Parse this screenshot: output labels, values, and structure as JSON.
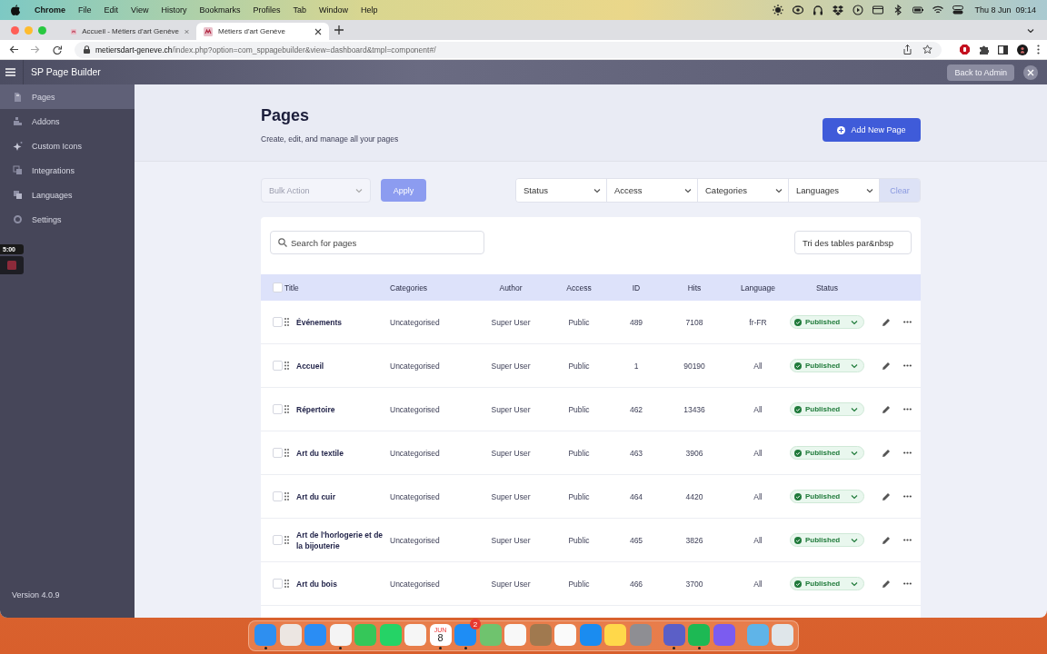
{
  "menubar": {
    "app": "Chrome",
    "menus": [
      "File",
      "Edit",
      "View",
      "History",
      "Bookmarks",
      "Profiles",
      "Tab",
      "Window",
      "Help"
    ],
    "clock": "Thu 8 Jun  09:14"
  },
  "browser": {
    "tabs": [
      {
        "title": "Accueil - Métiers d'art Genève",
        "selected": false
      },
      {
        "title": "Métiers d'art Genève",
        "selected": true
      }
    ],
    "url": {
      "host": "metiersdart-geneve.ch",
      "path": "/index.php?option=com_sppagebuilder&view=dashboard&tmpl=component#/"
    }
  },
  "app": {
    "title": "SP Page Builder",
    "back_button": "Back to Admin"
  },
  "sidebar": {
    "items": [
      {
        "label": "Pages",
        "selected": true
      },
      {
        "label": "Addons",
        "selected": false
      },
      {
        "label": "Custom Icons",
        "selected": false
      },
      {
        "label": "Integrations",
        "selected": false
      },
      {
        "label": "Languages",
        "selected": false
      },
      {
        "label": "Settings",
        "selected": false
      }
    ],
    "version": "Version 4.0.9"
  },
  "recording_widget": {
    "time": "5:00"
  },
  "page": {
    "title": "Pages",
    "subtitle": "Create, edit, and manage all your pages",
    "add_button": "Add New Page"
  },
  "toolbar": {
    "bulk_action": "Bulk Action",
    "apply": "Apply",
    "filters": [
      "Status",
      "Access",
      "Categories",
      "Languages"
    ],
    "clear": "Clear"
  },
  "search": {
    "placeholder": "Search for pages"
  },
  "sort_select": {
    "value": "Tri des tables par&nbsp"
  },
  "table": {
    "columns": [
      "Title",
      "Categories",
      "Author",
      "Access",
      "ID",
      "Hits",
      "Language",
      "Status"
    ],
    "all_checked": false,
    "rows": [
      {
        "title": "Événements",
        "category": "Uncategorised",
        "author": "Super User",
        "access": "Public",
        "id": "489",
        "hits": "7108",
        "language": "fr-FR",
        "status": "Published",
        "checked": false
      },
      {
        "title": "Accueil",
        "category": "Uncategorised",
        "author": "Super User",
        "access": "Public",
        "id": "1",
        "hits": "90190",
        "language": "All",
        "status": "Published",
        "checked": false
      },
      {
        "title": "Répertoire",
        "category": "Uncategorised",
        "author": "Super User",
        "access": "Public",
        "id": "462",
        "hits": "13436",
        "language": "All",
        "status": "Published",
        "checked": false
      },
      {
        "title": "Art du textile",
        "category": "Uncategorised",
        "author": "Super User",
        "access": "Public",
        "id": "463",
        "hits": "3906",
        "language": "All",
        "status": "Published",
        "checked": false
      },
      {
        "title": "Art du cuir",
        "category": "Uncategorised",
        "author": "Super User",
        "access": "Public",
        "id": "464",
        "hits": "4420",
        "language": "All",
        "status": "Published",
        "checked": false
      },
      {
        "title": "Art de l'horlogerie et de la bijouterie",
        "category": "Uncategorised",
        "author": "Super User",
        "access": "Public",
        "id": "465",
        "hits": "3826",
        "language": "All",
        "status": "Published",
        "checked": false
      },
      {
        "title": "Art du bois",
        "category": "Uncategorised",
        "author": "Super User",
        "access": "Public",
        "id": "466",
        "hits": "3700",
        "language": "All",
        "status": "Published",
        "checked": false
      }
    ]
  },
  "dock": {
    "items": [
      {
        "kind": "app",
        "color": "#2e8ff0",
        "running": true
      },
      {
        "kind": "app",
        "color": "#ece6e2",
        "running": false
      },
      {
        "kind": "app",
        "color": "#2a8df4",
        "running": false
      },
      {
        "kind": "app",
        "color": "#f4f4f4",
        "running": true
      },
      {
        "kind": "app",
        "color": "#35c759",
        "running": false
      },
      {
        "kind": "app",
        "color": "#25d366",
        "running": false
      },
      {
        "kind": "app",
        "color": "#f6f6f6",
        "running": false
      },
      {
        "kind": "calendar",
        "color": "#ffffff",
        "running": true,
        "month": "JUN",
        "day": "8"
      },
      {
        "kind": "app",
        "color": "#1e8df5",
        "running": true,
        "badge": "2"
      },
      {
        "kind": "app",
        "color": "#6fc36e",
        "running": false
      },
      {
        "kind": "app",
        "color": "#f8f8f8",
        "running": false
      },
      {
        "kind": "app",
        "color": "#a0794f",
        "running": false
      },
      {
        "kind": "app",
        "color": "#fafafa",
        "running": false
      },
      {
        "kind": "app",
        "color": "#1a8cf0",
        "running": false
      },
      {
        "kind": "app",
        "color": "#ffd84a",
        "running": false
      },
      {
        "kind": "app",
        "color": "#8e8e93",
        "running": false
      },
      {
        "kind": "separator"
      },
      {
        "kind": "app",
        "color": "#5b5fc7",
        "running": true
      },
      {
        "kind": "app",
        "color": "#1db954",
        "running": true
      },
      {
        "kind": "app",
        "color": "#7b5cf0",
        "running": false
      },
      {
        "kind": "separator"
      },
      {
        "kind": "app",
        "color": "#5fb4e8",
        "running": false
      },
      {
        "kind": "app",
        "color": "#dfe6ea",
        "running": false
      }
    ]
  }
}
